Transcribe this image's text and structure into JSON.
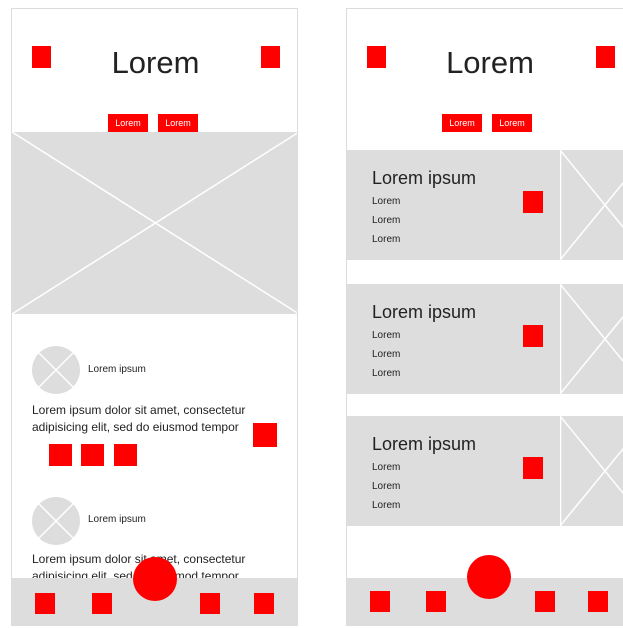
{
  "colors": {
    "accent": "#ff0000",
    "placeholder": "#dddddd",
    "text": "#222222"
  },
  "left_screen": {
    "title": "Lorem",
    "chips": [
      "Lorem",
      "Lorem"
    ],
    "posts": [
      {
        "author": "Lorem ipsum",
        "text": "Lorem ipsum dolor sit amet, consectetur adipisicing elit, sed do eiusmod tempor"
      },
      {
        "author": "Lorem ipsum",
        "text": "Lorem ipsum dolor sit amet, consectetur adipisicing elit, sed do eiusmod tempor"
      }
    ]
  },
  "right_screen": {
    "title": "Lorem",
    "chips": [
      "Lorem",
      "Lorem"
    ],
    "cards": [
      {
        "title": "Lorem ipsum",
        "lines": [
          "Lorem",
          "Lorem",
          "Lorem"
        ]
      },
      {
        "title": "Lorem ipsum",
        "lines": [
          "Lorem",
          "Lorem",
          "Lorem"
        ]
      },
      {
        "title": "Lorem ipsum",
        "lines": [
          "Lorem",
          "Lorem",
          "Lorem"
        ]
      }
    ]
  }
}
